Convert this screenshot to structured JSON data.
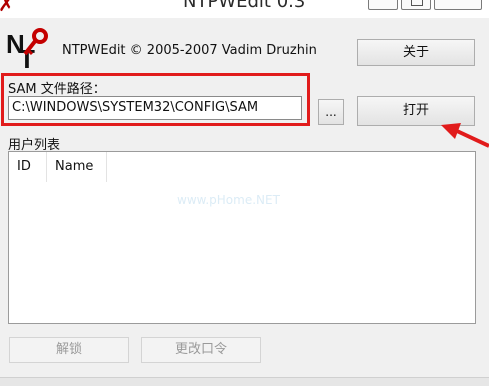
{
  "window": {
    "title": "NTPWEdit 0.3"
  },
  "header": {
    "about_text": "NTPWEdit © 2005-2007 Vadim Druzhin",
    "about_button": "关于"
  },
  "sam": {
    "label": "SAM 文件路径：",
    "path_value": "C:\\WINDOWS\\SYSTEM32\\CONFIG\\SAM",
    "browse_button": "...",
    "open_button": "打开"
  },
  "users": {
    "label": "用户列表",
    "columns": [
      "ID",
      "Name"
    ],
    "rows": []
  },
  "actions": {
    "unlock_button": "解锁",
    "change_password_button": "更改口令"
  },
  "colors": {
    "highlight": "#e11b1b",
    "logo_key": "#c40000"
  },
  "icons": {
    "logo": "ntpwedit-key-logo",
    "annotation": "red-arrow-icon"
  }
}
